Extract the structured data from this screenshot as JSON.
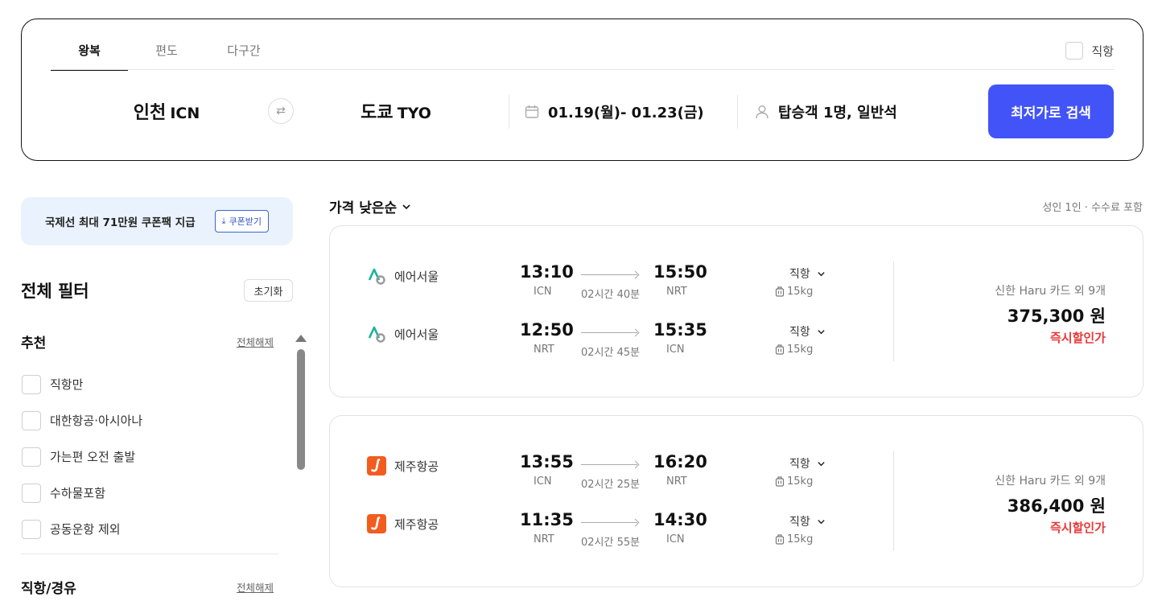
{
  "search": {
    "tabs": [
      "왕복",
      "편도",
      "다구간"
    ],
    "direct_label": "직항",
    "origin_city": "인천",
    "origin_code": "ICN",
    "dest_city": "도쿄",
    "dest_code": "TYO",
    "dates": "01.19(월)- 01.23(금)",
    "passengers": "탑승객 1명, 일반석",
    "search_button": "최저가로 검색"
  },
  "sidebar": {
    "coupon_text": "국제선 최대 71만원 쿠폰팩 지급",
    "coupon_button": "쿠폰받기",
    "filter_title": "전체 필터",
    "reset_button": "초기화",
    "sections": [
      {
        "title": "추천",
        "clear": "전체해제",
        "items": [
          "직항만",
          "대한항공·아시아나",
          "가는편 오전 출발",
          "수하물포함",
          "공동운항 제외"
        ]
      },
      {
        "title": "직항/경유",
        "clear": "전체해제"
      }
    ]
  },
  "results": {
    "sort_label": "가격 낮은순",
    "note": "성인 1인 · 수수료 포함",
    "cards": [
      {
        "legs": [
          {
            "airline": "에어서울",
            "dep_time": "13:10",
            "dep_airport": "ICN",
            "duration": "02시간 40분",
            "arr_time": "15:50",
            "arr_airport": "NRT",
            "direct": "직항",
            "baggage": "15kg"
          },
          {
            "airline": "에어서울",
            "dep_time": "12:50",
            "dep_airport": "NRT",
            "duration": "02시간 45분",
            "arr_time": "15:35",
            "arr_airport": "ICN",
            "direct": "직항",
            "baggage": "15kg"
          }
        ],
        "card_promo": "신한 Haru 카드 외 9개",
        "price": "375,300 원",
        "discount": "즉시할인가"
      },
      {
        "legs": [
          {
            "airline": "제주항공",
            "dep_time": "13:55",
            "dep_airport": "ICN",
            "duration": "02시간 25분",
            "arr_time": "16:20",
            "arr_airport": "NRT",
            "direct": "직항",
            "baggage": "15kg"
          },
          {
            "airline": "제주항공",
            "dep_time": "11:35",
            "dep_airport": "NRT",
            "duration": "02시간 55분",
            "arr_time": "14:30",
            "arr_airport": "ICN",
            "direct": "직항",
            "baggage": "15kg"
          }
        ],
        "card_promo": "신한 Haru 카드 외 9개",
        "price": "386,400 원",
        "discount": "즉시할인가"
      }
    ]
  },
  "colors": {
    "accent": "#4253f8",
    "discount": "#e83838",
    "coupon_bg": "#eaf3fd",
    "airseoul_green": "#19b39b",
    "jeju_orange": "#f25c1f"
  }
}
